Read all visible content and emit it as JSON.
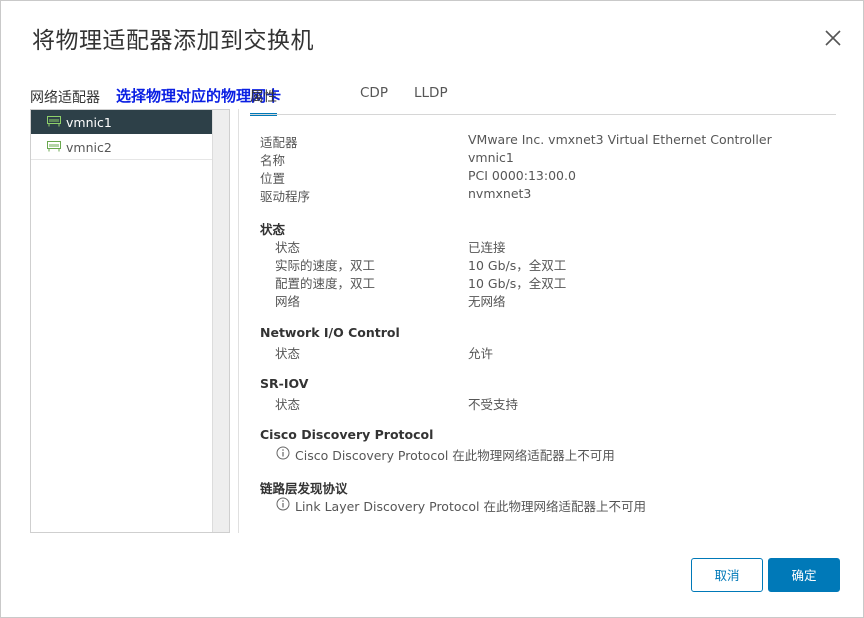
{
  "dialog": {
    "title": "将物理适配器添加到交换机",
    "left_label": "网络适配器",
    "annotation": "选择物理对应的物理网卡"
  },
  "tabs": [
    {
      "label": "属性",
      "active": true
    },
    {
      "label": "CDP",
      "active": false
    },
    {
      "label": "LLDP",
      "active": false
    }
  ],
  "adapters": [
    {
      "name": "vmnic1",
      "selected": true
    },
    {
      "name": "vmnic2",
      "selected": false
    }
  ],
  "properties": {
    "rows": [
      {
        "key": "适配器",
        "value": "VMware Inc. vmxnet3 Virtual Ethernet Controller"
      },
      {
        "key": "名称",
        "value": "vmnic1"
      },
      {
        "key": "位置",
        "value": "PCI 0000:13:00.0"
      },
      {
        "key": "驱动程序",
        "value": "nvmxnet3"
      }
    ],
    "status": {
      "heading": "状态",
      "rows": [
        {
          "key": "状态",
          "value": "已连接"
        },
        {
          "key": "实际的速度，双工",
          "value": "10 Gb/s，全双工"
        },
        {
          "key": "配置的速度，双工",
          "value": "10 Gb/s，全双工"
        },
        {
          "key": "网络",
          "value": "无网络"
        }
      ]
    },
    "nioc": {
      "heading": "Network I/O Control",
      "key": "状态",
      "value": "允许"
    },
    "sriov": {
      "heading": "SR-IOV",
      "key": "状态",
      "value": "不受支持"
    },
    "cdp": {
      "heading": "Cisco Discovery Protocol",
      "note": "Cisco Discovery Protocol 在此物理网络适配器上不可用"
    },
    "lldp": {
      "heading": "链路层发现协议",
      "note": "Link Layer Discovery Protocol 在此物理网络适配器上不可用"
    }
  },
  "buttons": {
    "cancel": "取消",
    "ok": "确定"
  },
  "colors": {
    "accent": "#0079b8",
    "selected_row": "#2d4048",
    "annotation": "#0a1fe3",
    "nic_icon": "#6aa84f"
  }
}
